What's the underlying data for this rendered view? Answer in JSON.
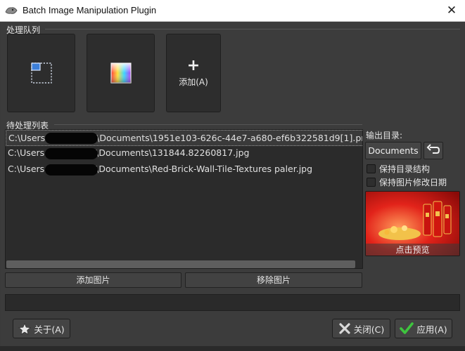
{
  "window": {
    "title": "Batch Image Manipulation Plugin",
    "close_glyph": "✕"
  },
  "queue": {
    "label": "处理队列",
    "tiles": [
      {
        "icon": "crop-icon"
      },
      {
        "icon": "color-gradient-icon"
      }
    ],
    "add_tile": {
      "plus": "+",
      "label": "添加(A)"
    }
  },
  "pending": {
    "label": "待处理列表",
    "files": [
      {
        "prefix": "C:\\Users",
        "suffix": "\\Documents\\1951e103-626c-44e7-a680-ef6b322581d9[1].pn",
        "selected": true
      },
      {
        "prefix": "C:\\Users",
        "suffix": "\\Documents\\131844.82260817.jpg",
        "selected": false
      },
      {
        "prefix": "C:\\Users",
        "suffix": "\\Documents\\Red-Brick-Wall-Tile-Textures paler.jpg",
        "selected": false
      }
    ],
    "add_button": "添加图片",
    "remove_button": "移除图片"
  },
  "output": {
    "label": "输出目录:",
    "folder_button": "Documents",
    "keep_structure_label": "保持目录结构",
    "keep_structure_checked": false,
    "keep_date_label": "保持图片修改日期",
    "keep_date_checked": false,
    "preview_label": "点击预览"
  },
  "footer": {
    "about_button": "关于(A)",
    "close_button": "关闭(C)",
    "apply_button": "应用(A)"
  },
  "colors": {
    "background": "#3c3c3c",
    "panel": "#2b2b2b",
    "text": "#e6e6e6",
    "close_x": "#d9d9d9",
    "apply_check": "#3ec43e"
  }
}
